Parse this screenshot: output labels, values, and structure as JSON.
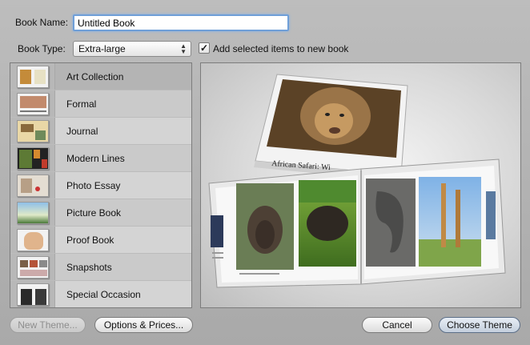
{
  "form": {
    "book_name_label": "Book Name:",
    "book_name_value": "Untitled Book",
    "book_type_label": "Book Type:",
    "book_type_value": "Extra-large",
    "add_selected_label": "Add selected items to new book",
    "add_selected_checked": "✓"
  },
  "themes": [
    {
      "label": "Art Collection",
      "icon": "art-collection-thumbnail"
    },
    {
      "label": "Formal",
      "icon": "formal-thumbnail"
    },
    {
      "label": "Journal",
      "icon": "journal-thumbnail"
    },
    {
      "label": "Modern Lines",
      "icon": "modern-lines-thumbnail"
    },
    {
      "label": "Photo Essay",
      "icon": "photo-essay-thumbnail"
    },
    {
      "label": "Picture Book",
      "icon": "picture-book-thumbnail"
    },
    {
      "label": "Proof Book",
      "icon": "proof-book-thumbnail"
    },
    {
      "label": "Snapshots",
      "icon": "snapshots-thumbnail"
    },
    {
      "label": "Special Occasion",
      "icon": "special-occasion-thumbnail"
    }
  ],
  "selected_theme": "Art Collection",
  "preview": {
    "cover_caption": "African Safari: Wi"
  },
  "buttons": {
    "new_theme": "New Theme...",
    "options_prices": "Options & Prices...",
    "cancel": "Cancel",
    "choose_theme": "Choose Theme"
  },
  "colors": {
    "focus_ring": "#6f9fd8",
    "selected_row": "#b4b4b4"
  }
}
